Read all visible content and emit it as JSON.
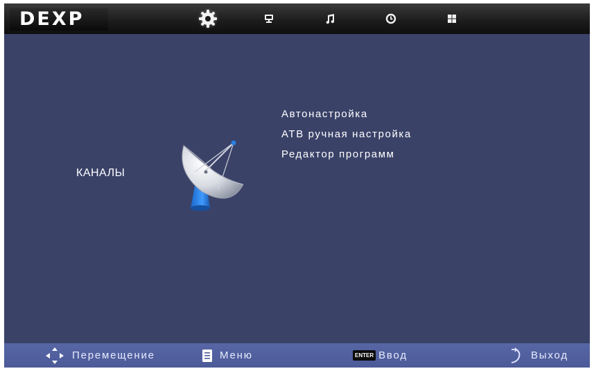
{
  "brand": {
    "logo_text": "DEXP"
  },
  "tabs": [
    {
      "icon": "gear-icon",
      "active": true
    },
    {
      "icon": "monitor-icon",
      "active": false
    },
    {
      "icon": "music-note-icon",
      "active": false
    },
    {
      "icon": "clock-icon",
      "active": false
    },
    {
      "icon": "grid-icon",
      "active": false
    }
  ],
  "section": {
    "title": "КАНАЛЫ",
    "icon": "satellite-dish-icon"
  },
  "menu": {
    "items": [
      {
        "label": "Автонастройка"
      },
      {
        "label": "АТВ ручная настройка"
      },
      {
        "label": "Редактор программ"
      }
    ]
  },
  "footer": {
    "move_label": "Перемещение",
    "menu_label": "Меню",
    "enter_key": "ENTER",
    "enter_label": "Ввод",
    "exit_label": "Выход"
  },
  "colors": {
    "background": "#3a4268",
    "top_bar": "#1b1b1b",
    "bottom_bar": "#5766a5",
    "text": "#ffffff"
  }
}
